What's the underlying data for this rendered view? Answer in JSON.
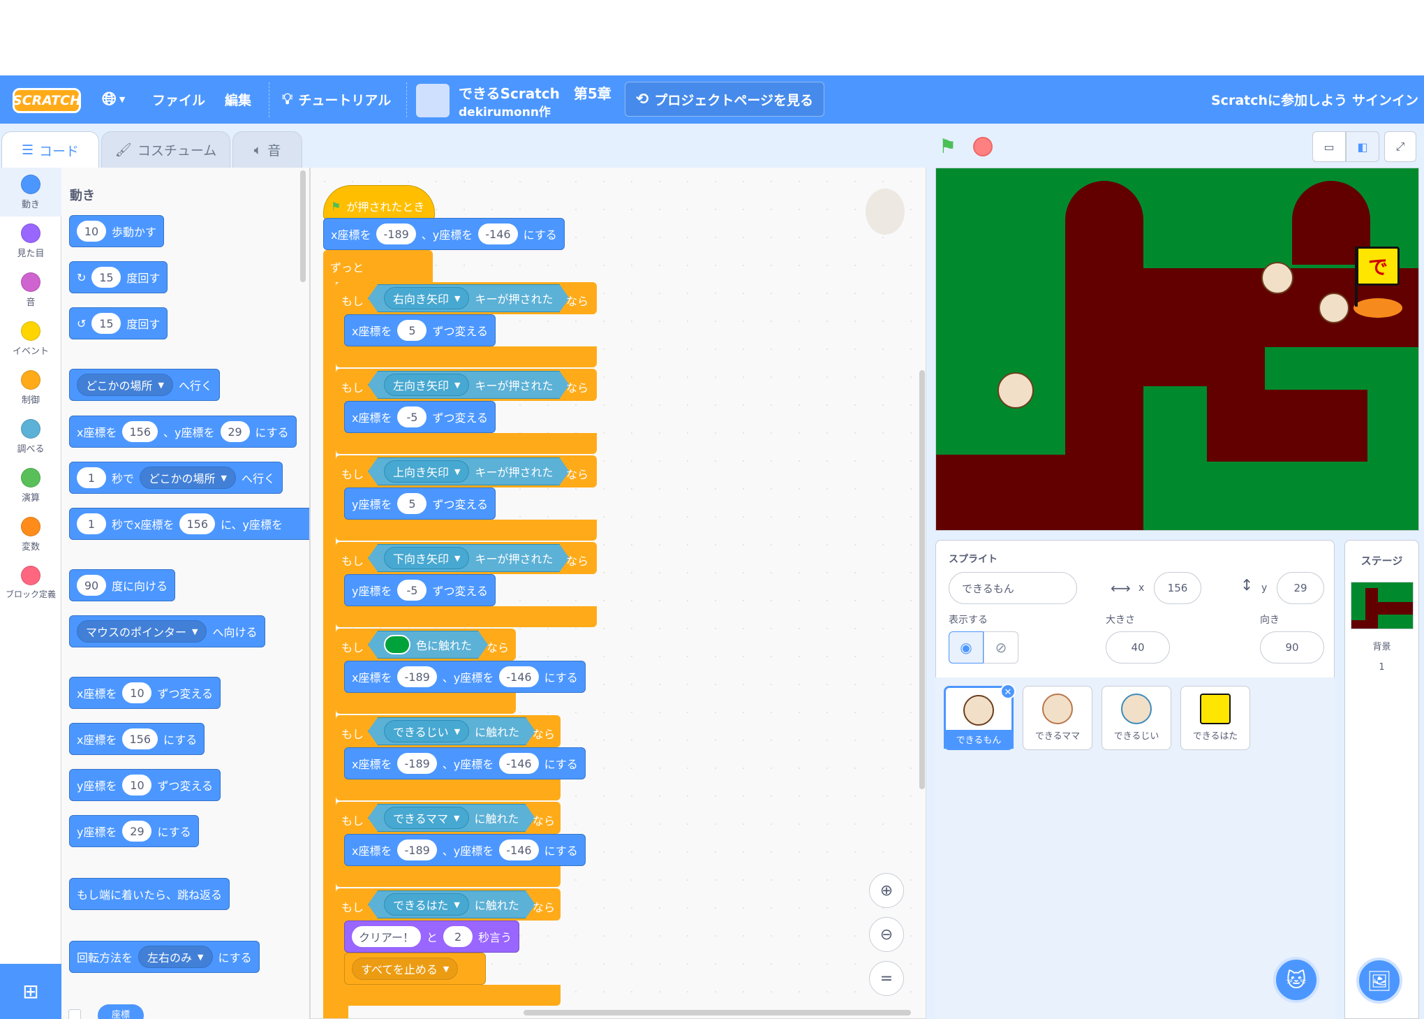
{
  "menubar": {
    "logo": "SCRATCH",
    "file": "ファイル",
    "edit": "編集",
    "tutorials": "チュートリアル",
    "project_title": "できるScratch　第5章",
    "project_author": "dekirumonn作",
    "see_project_page": "プロジェクトページを見る",
    "join": "Scratchに参加しよう",
    "sign_in": "サインイン"
  },
  "tabs": {
    "code": "コード",
    "costumes": "コスチューム",
    "sounds": "音"
  },
  "categories": [
    {
      "label": "動き",
      "color": "#4c97ff"
    },
    {
      "label": "見た目",
      "color": "#9966ff"
    },
    {
      "label": "音",
      "color": "#cf63cf"
    },
    {
      "label": "イベント",
      "color": "#ffd500"
    },
    {
      "label": "制御",
      "color": "#ffab19"
    },
    {
      "label": "調べる",
      "color": "#5cb1d6"
    },
    {
      "label": "演算",
      "color": "#59c059"
    },
    {
      "label": "変数",
      "color": "#ff8c1a"
    },
    {
      "label": "ブロック定義",
      "color": "#ff6680"
    }
  ],
  "palette": {
    "section_title": "動き",
    "move_steps": {
      "value": "10",
      "text": "歩動かす"
    },
    "turn_right": {
      "value": "15",
      "text": "度回す"
    },
    "turn_left": {
      "value": "15",
      "text": "度回す"
    },
    "goto": {
      "menu": "どこかの場所",
      "text": "へ行く"
    },
    "goto_xy": {
      "x_label": "x座標を",
      "x": "156",
      "y_label": "、y座標を",
      "y": "29",
      "suffix": "にする"
    },
    "glide": {
      "secs": "1",
      "text1": "秒で",
      "menu": "どこかの場所",
      "text2": "へ行く"
    },
    "glide_xy": {
      "secs": "1",
      "text1": "秒でx座標を",
      "x": "156",
      "text2": "に、y座標を"
    },
    "point_dir": {
      "value": "90",
      "text": "度に向ける"
    },
    "point_towards": {
      "menu": "マウスのポインター",
      "text": "へ向ける"
    },
    "change_x": {
      "label": "x座標を",
      "value": "10",
      "text": "ずつ変える"
    },
    "set_x": {
      "label": "x座標を",
      "value": "156",
      "text": "にする"
    },
    "change_y": {
      "label": "y座標を",
      "value": "10",
      "text": "ずつ変える"
    },
    "set_y": {
      "label": "y座標を",
      "value": "29",
      "text": "にする"
    },
    "bounce": "もし端に着いたら、跳ね返る",
    "rotation": {
      "label": "回転方法を",
      "menu": "左右のみ",
      "text": "にする"
    },
    "xpos_partial": "座標"
  },
  "script": {
    "hat": "が押されたとき",
    "goto_start": {
      "x_label": "x座標を",
      "x": "-189",
      "y_label": "、y座標を",
      "y": "-146",
      "suffix": "にする"
    },
    "forever": "ずっと",
    "if_label": "もし",
    "then_label": "なら",
    "key_pressed": "キーが押された",
    "change_by": "ずつ変える",
    "x_label": "x座標を",
    "y_label": "y座標を",
    "y_label2": "、y座標を",
    "set_suffix": "にする",
    "right_key": "右向き矢印",
    "left_key": "左向き矢印",
    "up_key": "上向き矢印",
    "down_key": "下向き矢印",
    "right_val": "5",
    "left_val": "-5",
    "up_val": "5",
    "down_val": "-5",
    "touching_color": "色に触れた",
    "touching": "に触れた",
    "target_color": "#00a23b",
    "reset_x": "-189",
    "reset_y": "-146",
    "jii": "できるじい",
    "mama": "できるママ",
    "hata": "できるはた",
    "say_text": "クリアー！",
    "say_and": "と",
    "say_secs": "2",
    "say_suffix": "秒言う",
    "stop_all": "すべてを止める"
  },
  "sprite_info": {
    "sprite_label": "スプライト",
    "sprite_name": "できるもん",
    "x_label": "x",
    "x": "156",
    "y_label": "y",
    "y": "29",
    "show_label": "表示する",
    "size_label": "大きさ",
    "size": "40",
    "direction_label": "向き",
    "direction": "90"
  },
  "sprites": [
    "できるもん",
    "できるママ",
    "できるじい",
    "できるはた"
  ],
  "stage_pane": {
    "title": "ステージ",
    "backdrop_label": "背景",
    "backdrop_count": "1"
  },
  "colors": {
    "brand": "#4c97ff",
    "maze_wall": "#620000",
    "grass": "#008a2d"
  }
}
